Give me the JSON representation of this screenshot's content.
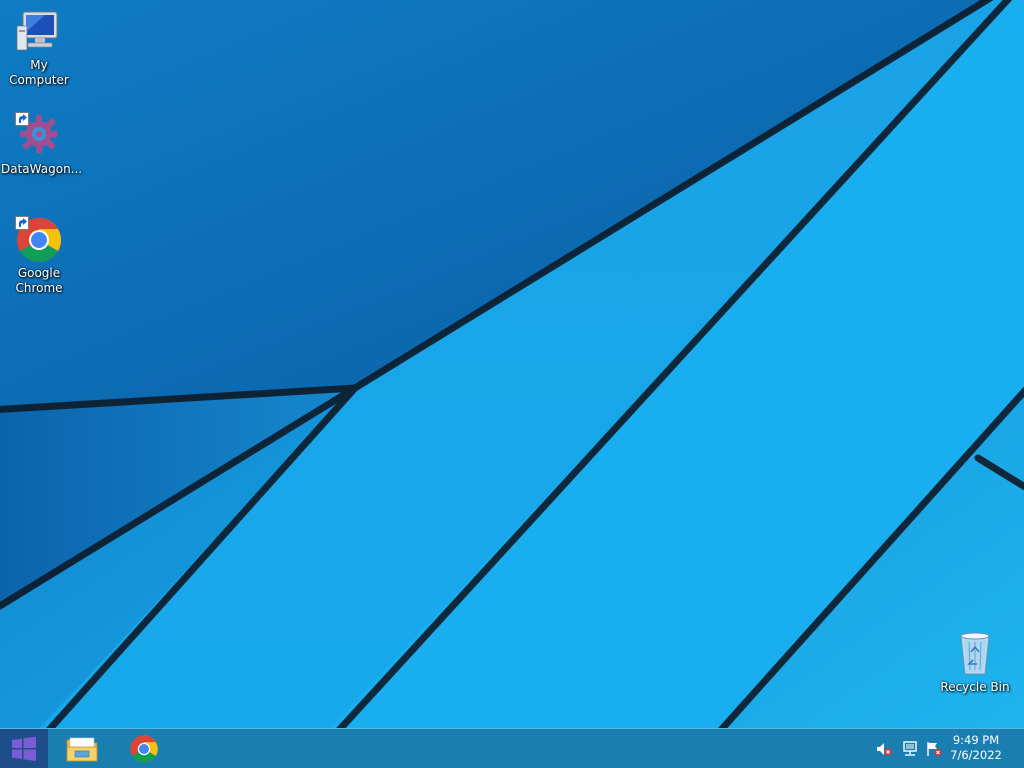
{
  "desktop": {
    "icons": [
      {
        "label": "My Computer",
        "icon": "computer-icon"
      },
      {
        "label": "DataWagon...",
        "icon": "datawagon-gear-icon",
        "shortcut": true
      },
      {
        "label_line1": "Google",
        "label_line2": "Chrome",
        "icon": "chrome-icon",
        "shortcut": true
      },
      {
        "label": "Recycle Bin",
        "icon": "recycle-bin-icon"
      }
    ]
  },
  "taskbar": {
    "start_icon": "windows-logo-icon",
    "pinned": [
      {
        "name": "File Explorer",
        "icon": "folder-icon"
      },
      {
        "name": "Google Chrome",
        "icon": "chrome-icon"
      }
    ],
    "tray": {
      "icons": [
        "volume-muted-icon",
        "network-icon",
        "action-center-flag-icon"
      ],
      "time": "9:49 PM",
      "date": "7/6/2022"
    }
  },
  "colors": {
    "wallpaper": "#1aa6e6",
    "wallpaper_dark": "#0a5fa8",
    "taskbar": "#1a7fb0",
    "start_button": "#1d4e8a"
  }
}
